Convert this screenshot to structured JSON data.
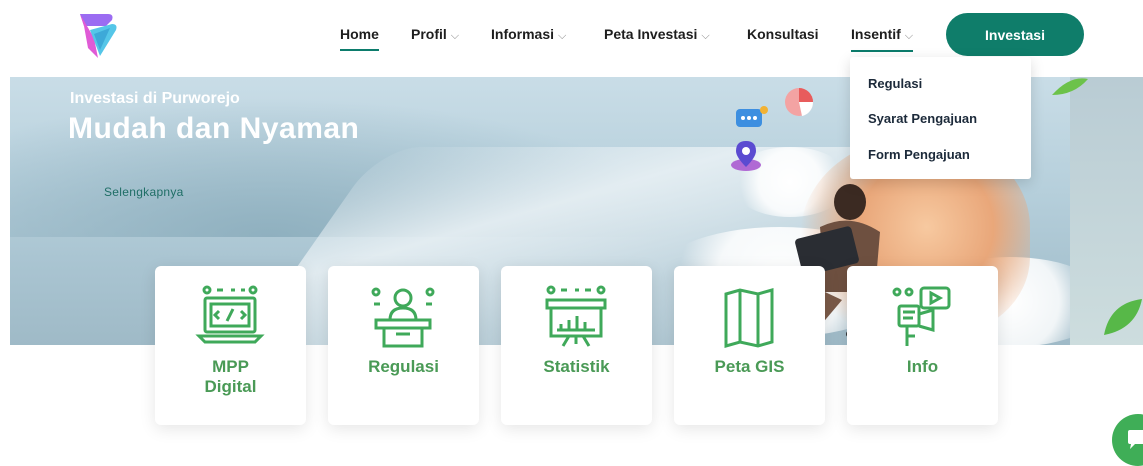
{
  "header": {
    "nav": [
      {
        "label": "Home",
        "active": true,
        "has_dropdown": false
      },
      {
        "label": "Profil",
        "has_dropdown": true
      },
      {
        "label": "Informasi",
        "has_dropdown": true
      },
      {
        "label": "Peta Investasi",
        "has_dropdown": true
      },
      {
        "label": "Konsultasi",
        "has_dropdown": false
      },
      {
        "label": "Insentif",
        "has_dropdown": true,
        "open": true
      }
    ],
    "cta_label": "Investasi",
    "chevron_glyph": "⌵"
  },
  "dropdown": {
    "items": [
      "Regulasi",
      "Syarat Pengajuan",
      "Form Pengajuan"
    ]
  },
  "hero": {
    "subtitle": "Investasi di Purworejo",
    "title": "Mudah dan Nyaman",
    "link": "Selengkapnya"
  },
  "cards": [
    {
      "line1": "MPP",
      "line2": "Digital",
      "icon": "computer-code-icon"
    },
    {
      "line1": "Regulasi",
      "line2": "",
      "icon": "speaker-podium-icon"
    },
    {
      "line1": "Statistik",
      "line2": "",
      "icon": "presentation-chart-icon"
    },
    {
      "line1": "Peta GIS",
      "line2": "",
      "icon": "folded-map-icon"
    },
    {
      "line1": "Info",
      "line2": "",
      "icon": "info-media-icon"
    }
  ],
  "colors": {
    "brand_green": "#0f7d6a",
    "card_green": "#4a9a56",
    "chat_green": "#3fae57"
  }
}
